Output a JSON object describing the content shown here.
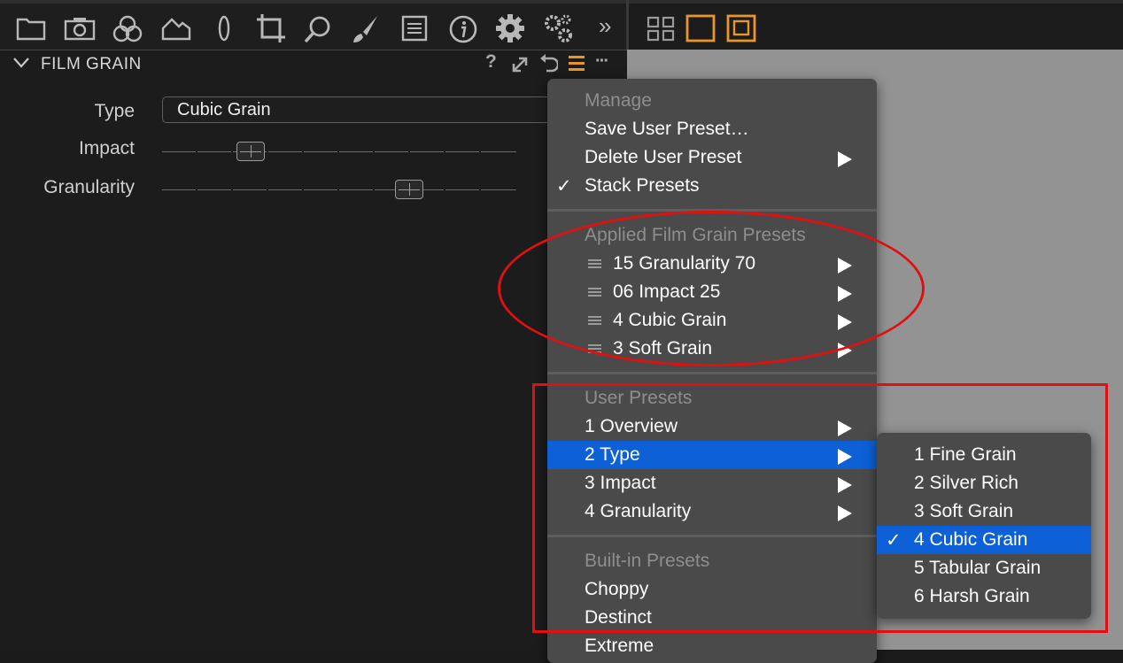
{
  "toolbar": {
    "icons": [
      "folder-icon",
      "camera-icon",
      "color-circles-icon",
      "exposure-icon",
      "lens-icon",
      "crop-icon",
      "loupe-icon",
      "brush-icon",
      "metadata-icon",
      "info-icon",
      "gear-icon",
      "gears-icon",
      "more-tools-icon"
    ],
    "view_icons": [
      "grid-view-icon",
      "single-view-icon",
      "multi-view-icon"
    ],
    "accent": "#e8962c",
    "overflow_label": "»"
  },
  "tool": {
    "title": "FILM GRAIN",
    "header_icons": [
      "help-icon",
      "expand-icon",
      "reset-icon",
      "presets-menu-icon",
      "more-icon"
    ],
    "help_label": "?",
    "more_label": "···",
    "fields": {
      "type_label": "Type",
      "type_value": "Cubic Grain",
      "impact_label": "Impact",
      "impact_value": 25,
      "granularity_label": "Granularity",
      "granularity_value": 70
    }
  },
  "menu": {
    "manage_header": "Manage",
    "save": "Save User Preset…",
    "delete": "Delete User Preset",
    "stack": "Stack Presets",
    "check": "✓",
    "applied_header": "Applied Film Grain Presets",
    "applied": [
      "15 Granularity 70",
      "06 Impact 25",
      "4 Cubic Grain",
      "3 Soft Grain"
    ],
    "user_header": "User Presets",
    "user": [
      "1 Overview",
      "2 Type",
      "3 Impact",
      "4 Granularity"
    ],
    "builtin_header": "Built-in Presets",
    "builtin": [
      "Choppy",
      "Destinct",
      "Extreme"
    ]
  },
  "submenu": {
    "items": [
      "1 Fine Grain",
      "2 Silver Rich",
      "3 Soft Grain",
      "4 Cubic Grain",
      "5 Tabular Grain",
      "6 Harsh Grain"
    ],
    "check": "✓"
  },
  "colors": {
    "highlight": "#0d60d6",
    "annotation": "#e01010"
  }
}
